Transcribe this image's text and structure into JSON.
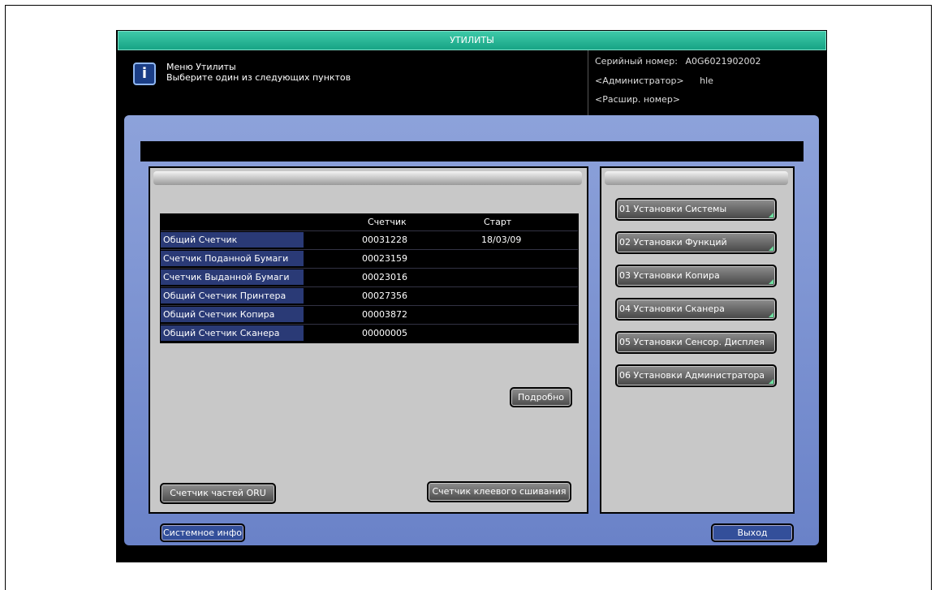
{
  "title": "УТИЛИТЫ",
  "header": {
    "icon": "info-icon",
    "message_line1": "Меню Утилиты",
    "message_line2": "Выберите один из следующих пунктов",
    "serial_label": "Серийный номер:",
    "serial_value": "A0G6021902002",
    "admin_label": "<Администратор>",
    "admin_value": "hle",
    "ext_number_label": "<Расшир. номер>"
  },
  "counter_table": {
    "col_counter": "Счетчик",
    "col_start": "Старт",
    "rows": [
      {
        "label": "Общий Счетчик",
        "count": "00031228",
        "start": "18/03/09"
      },
      {
        "label": "Счетчик Поданной Бумаги",
        "count": "00023159",
        "start": ""
      },
      {
        "label": "Счетчик Выданной Бумаги",
        "count": "00023016",
        "start": ""
      },
      {
        "label": "Общий Счетчик Принтера",
        "count": "00027356",
        "start": ""
      },
      {
        "label": "Общий Счетчик Копира",
        "count": "00003872",
        "start": ""
      },
      {
        "label": "Общий Счетчик Сканера",
        "count": "00000005",
        "start": ""
      }
    ]
  },
  "buttons": {
    "details": "Подробно",
    "oru_counter": "Счетчик частей ORU",
    "glue_counter": "Счетчик клеевого сшивания",
    "system_info": "Системное инфо",
    "exit": "Выход"
  },
  "settings": [
    "01 Установки Системы",
    "02 Установки Функций",
    "03 Установки Копира",
    "04 Установки Сканера",
    "05 Установки Сенсор. Дисплея",
    "06 Установки Администратора"
  ],
  "colors": {
    "title_bar": "#17a485",
    "main_panel": "#7b90d0",
    "accent_corner": "#6de0a0"
  }
}
